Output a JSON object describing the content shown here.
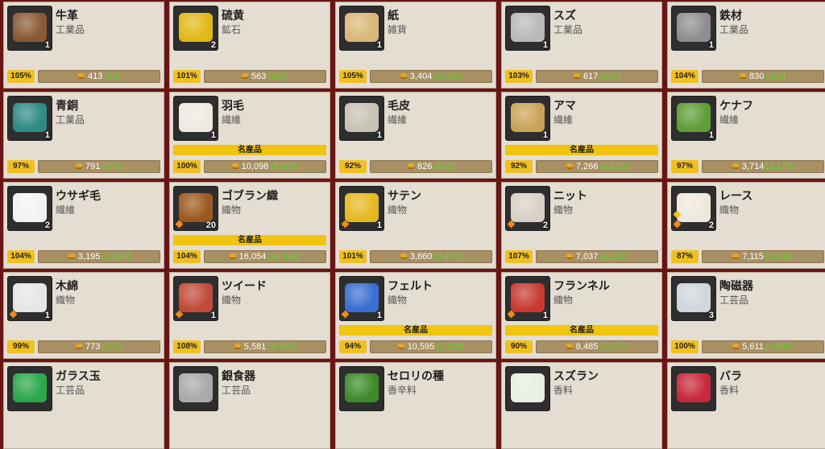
{
  "banner_label": "名産品",
  "items": [
    {
      "name": "牛革",
      "category": "工業品",
      "count": "1",
      "percent": "105%",
      "price": "413",
      "diff": "(53)",
      "banner": false,
      "gems": 0,
      "color": "#8a5a33",
      "icon": "leather-icon"
    },
    {
      "name": "硫黄",
      "category": "鉱石",
      "count": "2",
      "percent": "101%",
      "price": "563",
      "diff": "(214)",
      "banner": false,
      "gems": 0,
      "color": "#e2b818",
      "icon": "sulfur-icon"
    },
    {
      "name": "紙",
      "category": "雑貨",
      "count": "1",
      "percent": "105%",
      "price": "3,404",
      "diff": "(3,052)",
      "banner": false,
      "gems": 0,
      "color": "#d9b878",
      "icon": "paper-icon"
    },
    {
      "name": "スズ",
      "category": "工業品",
      "count": "1",
      "percent": "103%",
      "price": "617",
      "diff": "(235)",
      "banner": false,
      "gems": 0,
      "color": "#b9b9b9",
      "icon": "tin-ingot-icon"
    },
    {
      "name": "鉄材",
      "category": "工業品",
      "count": "1",
      "percent": "104%",
      "price": "830",
      "diff": "(328)",
      "banner": false,
      "gems": 0,
      "color": "#8e8e8e",
      "icon": "iron-bar-icon"
    },
    {
      "name": "青銅",
      "category": "工業品",
      "count": "1",
      "percent": "97%",
      "price": "791",
      "diff": "(154)",
      "banner": false,
      "gems": 0,
      "color": "#2f8a84",
      "icon": "bronze-ingot-icon"
    },
    {
      "name": "羽毛",
      "category": "繊維",
      "count": "1",
      "percent": "100%",
      "price": "10,098",
      "diff": "(9,268)",
      "banner": true,
      "gems": 0,
      "color": "#eeeae0",
      "icon": "feather-icon"
    },
    {
      "name": "毛皮",
      "category": "繊維",
      "count": "1",
      "percent": "92%",
      "price": "826",
      "diff": "(433)",
      "banner": false,
      "gems": 0,
      "color": "#c9c2b4",
      "icon": "fur-icon"
    },
    {
      "name": "アマ",
      "category": "繊維",
      "count": "1",
      "percent": "92%",
      "price": "7,266",
      "diff": "(6,618)",
      "banner": true,
      "gems": 0,
      "color": "#c9a457",
      "icon": "flax-icon"
    },
    {
      "name": "ケナフ",
      "category": "繊維",
      "count": "1",
      "percent": "97%",
      "price": "3,714",
      "diff": "(3,173)",
      "banner": false,
      "gems": 0,
      "color": "#5f9e37",
      "icon": "kenaf-icon"
    },
    {
      "name": "ウサギ毛",
      "category": "繊維",
      "count": "2",
      "percent": "104%",
      "price": "3,195",
      "diff": "(2,854)",
      "banner": false,
      "gems": 0,
      "color": "#f3f3f3",
      "icon": "rabbit-icon"
    },
    {
      "name": "ゴブラン織",
      "category": "織物",
      "count": "20",
      "percent": "104%",
      "price": "16,054",
      "diff": "(14,463)",
      "banner": true,
      "gems": 1,
      "color": "#9c5a20",
      "icon": "gobelin-icon"
    },
    {
      "name": "サテン",
      "category": "織物",
      "count": "1",
      "percent": "101%",
      "price": "3,860",
      "diff": "(3,454)",
      "banner": false,
      "gems": 1,
      "color": "#e6b820",
      "icon": "satin-icon"
    },
    {
      "name": "ニット",
      "category": "織物",
      "count": "2",
      "percent": "107%",
      "price": "7,037",
      "diff": "(6,202)",
      "banner": false,
      "gems": 1,
      "color": "#d8d0c4",
      "icon": "knit-icon"
    },
    {
      "name": "レース",
      "category": "織物",
      "count": "2",
      "percent": "87%",
      "price": "7,115",
      "diff": "(6,068)",
      "banner": false,
      "gems": 2,
      "color": "#efe8dc",
      "icon": "lace-icon"
    },
    {
      "name": "木綿",
      "category": "織物",
      "count": "1",
      "percent": "99%",
      "price": "773",
      "diff": "(242)",
      "banner": false,
      "gems": 1,
      "color": "#e6e6e6",
      "icon": "cotton-icon"
    },
    {
      "name": "ツイード",
      "category": "織物",
      "count": "1",
      "percent": "108%",
      "price": "5,581",
      "diff": "(4,956)",
      "banner": false,
      "gems": 1,
      "color": "#c04a3a",
      "icon": "tweed-icon"
    },
    {
      "name": "フェルト",
      "category": "織物",
      "count": "1",
      "percent": "94%",
      "price": "10,595",
      "diff": "(9,628)",
      "banner": true,
      "gems": 1,
      "color": "#3a6fd0",
      "icon": "felt-icon"
    },
    {
      "name": "フランネル",
      "category": "織物",
      "count": "1",
      "percent": "90%",
      "price": "8,485",
      "diff": "(7,357)",
      "banner": true,
      "gems": 1,
      "color": "#c83a30",
      "icon": "flannel-icon"
    },
    {
      "name": "陶磁器",
      "category": "工芸品",
      "count": "3",
      "percent": "100%",
      "price": "5,611",
      "diff": "(4,882)",
      "banner": false,
      "gems": 0,
      "color": "#cfd6dc",
      "icon": "porcelain-icon"
    },
    {
      "name": "ガラス玉",
      "category": "工芸品",
      "count": "",
      "percent": "",
      "price": "",
      "diff": "",
      "banner": false,
      "gems": 0,
      "color": "#2aa84a",
      "icon": "glass-bead-icon"
    },
    {
      "name": "銀食器",
      "category": "工芸品",
      "count": "",
      "percent": "",
      "price": "",
      "diff": "",
      "banner": false,
      "gems": 0,
      "color": "#a9a9a9",
      "icon": "silverware-icon"
    },
    {
      "name": "セロリの種",
      "category": "香辛料",
      "count": "",
      "percent": "",
      "price": "",
      "diff": "",
      "banner": false,
      "gems": 0,
      "color": "#3c8a2a",
      "icon": "celery-seed-icon"
    },
    {
      "name": "スズラン",
      "category": "香料",
      "count": "",
      "percent": "",
      "price": "",
      "diff": "",
      "banner": false,
      "gems": 0,
      "color": "#e8efe0",
      "icon": "lily-of-the-valley-icon"
    },
    {
      "name": "バラ",
      "category": "香料",
      "count": "",
      "percent": "",
      "price": "",
      "diff": "",
      "banner": false,
      "gems": 0,
      "color": "#c8283a",
      "icon": "rose-icon"
    }
  ]
}
